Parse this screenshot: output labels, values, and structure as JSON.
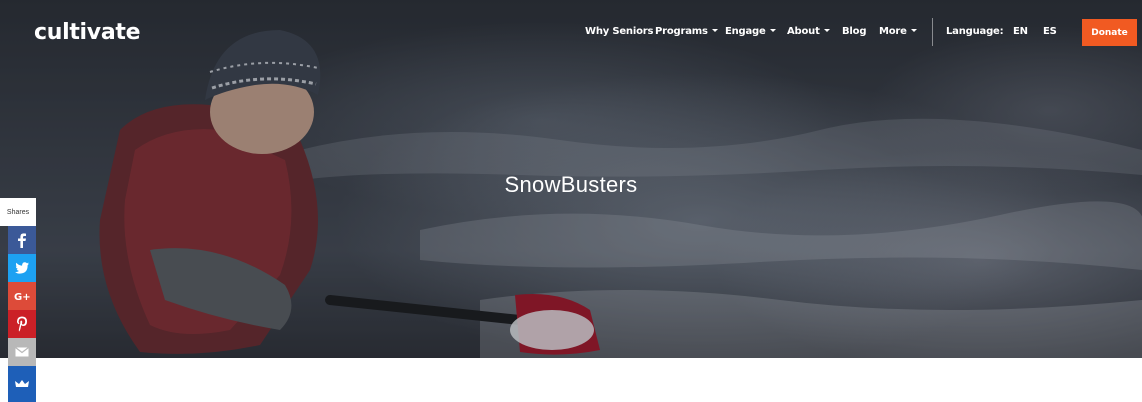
{
  "brand": {
    "logo_text": "cultivate"
  },
  "nav": {
    "items": [
      {
        "label": "Why Seniors",
        "has_dropdown": false
      },
      {
        "label": "Programs",
        "has_dropdown": true
      },
      {
        "label": "Engage",
        "has_dropdown": true
      },
      {
        "label": "About",
        "has_dropdown": true
      },
      {
        "label": "Blog",
        "has_dropdown": false
      },
      {
        "label": "More",
        "has_dropdown": true
      }
    ],
    "language_label": "Language:",
    "languages": [
      "EN",
      "ES"
    ],
    "donate_label": "Donate"
  },
  "hero": {
    "title": "SnowBusters"
  },
  "share": {
    "label": "Shares",
    "buttons": [
      {
        "network": "facebook",
        "icon": "facebook-icon",
        "color": "#3b5998"
      },
      {
        "network": "twitter",
        "icon": "twitter-icon",
        "color": "#1da1f2"
      },
      {
        "network": "google-plus",
        "icon": "google-plus-icon",
        "color": "#dd4b39"
      },
      {
        "network": "pinterest",
        "icon": "pinterest-icon",
        "color": "#cb2027"
      },
      {
        "network": "email",
        "icon": "email-icon",
        "color": "#b8b8b8"
      },
      {
        "network": "crown",
        "icon": "crown-icon",
        "color": "#1e5fb8"
      }
    ]
  },
  "colors": {
    "accent": "#f15a22"
  }
}
